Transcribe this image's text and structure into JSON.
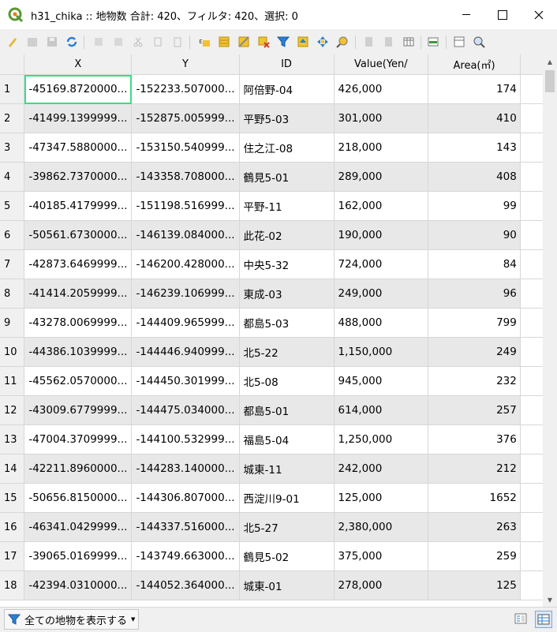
{
  "window": {
    "title": "h31_chika :: 地物数 合計: 420、フィルタ: 420、選択: 0",
    "minimize": "—",
    "maximize": "☐",
    "close": "✕"
  },
  "toolbar_icons": [
    "toggle-edit-icon",
    "multi-edit-icon",
    "save-edits-icon",
    "reload-icon",
    "add-feature-icon",
    "delete-feature-icon",
    "cut-icon",
    "copy-icon",
    "paste-icon",
    "select-by-expression-icon",
    "select-all-icon",
    "invert-selection-icon",
    "deselect-all-icon",
    "filter-select-icon",
    "move-selection-to-top-icon",
    "pan-to-selection-icon",
    "zoom-to-selection-icon",
    "copy-rows-icon",
    "paste-rows-icon",
    "delete-field-icon",
    "new-field-icon",
    "conditional-format-icon",
    "field-calculator-icon",
    "actions-icon"
  ],
  "table": {
    "columns": [
      "X",
      "Y",
      "ID",
      "Value(Yen/",
      "Area(㎡)"
    ],
    "rows": [
      {
        "n": "1",
        "x": "-45169.8720000...",
        "y": "-152233.507000...",
        "id": "阿倍野-04",
        "value": "426,000",
        "area": "174"
      },
      {
        "n": "2",
        "x": "-41499.1399999...",
        "y": "-152875.005999...",
        "id": "平野5-03",
        "value": "301,000",
        "area": "410"
      },
      {
        "n": "3",
        "x": "-47347.5880000...",
        "y": "-153150.540999...",
        "id": "住之江-08",
        "value": "218,000",
        "area": "143"
      },
      {
        "n": "4",
        "x": "-39862.7370000...",
        "y": "-143358.708000...",
        "id": "鶴見5-01",
        "value": "289,000",
        "area": "408"
      },
      {
        "n": "5",
        "x": "-40185.4179999...",
        "y": "-151198.516999...",
        "id": "平野-11",
        "value": "162,000",
        "area": "99"
      },
      {
        "n": "6",
        "x": "-50561.6730000...",
        "y": "-146139.084000...",
        "id": "此花-02",
        "value": "190,000",
        "area": "90"
      },
      {
        "n": "7",
        "x": "-42873.6469999...",
        "y": "-146200.428000...",
        "id": "中央5-32",
        "value": "724,000",
        "area": "84"
      },
      {
        "n": "8",
        "x": "-41414.2059999...",
        "y": "-146239.106999...",
        "id": "東成-03",
        "value": "249,000",
        "area": "96"
      },
      {
        "n": "9",
        "x": "-43278.0069999...",
        "y": "-144409.965999...",
        "id": "都島5-03",
        "value": "488,000",
        "area": "799"
      },
      {
        "n": "10",
        "x": "-44386.1039999...",
        "y": "-144446.940999...",
        "id": "北5-22",
        "value": "1,150,000",
        "area": "249"
      },
      {
        "n": "11",
        "x": "-45562.0570000...",
        "y": "-144450.301999...",
        "id": "北5-08",
        "value": "945,000",
        "area": "232"
      },
      {
        "n": "12",
        "x": "-43009.6779999...",
        "y": "-144475.034000...",
        "id": "都島5-01",
        "value": "614,000",
        "area": "257"
      },
      {
        "n": "13",
        "x": "-47004.3709999...",
        "y": "-144100.532999...",
        "id": "福島5-04",
        "value": "1,250,000",
        "area": "376"
      },
      {
        "n": "14",
        "x": "-42211.8960000...",
        "y": "-144283.140000...",
        "id": "城東-11",
        "value": "242,000",
        "area": "212"
      },
      {
        "n": "15",
        "x": "-50656.8150000...",
        "y": "-144306.807000...",
        "id": "西淀川9-01",
        "value": "125,000",
        "area": "1652"
      },
      {
        "n": "16",
        "x": "-46341.0429999...",
        "y": "-144337.516000...",
        "id": "北5-27",
        "value": "2,380,000",
        "area": "263"
      },
      {
        "n": "17",
        "x": "-39065.0169999...",
        "y": "-143749.663000...",
        "id": "鶴見5-02",
        "value": "375,000",
        "area": "259"
      },
      {
        "n": "18",
        "x": "-42394.0310000...",
        "y": "-144052.364000...",
        "id": "城東-01",
        "value": "278,000",
        "area": "125"
      }
    ]
  },
  "status": {
    "filter_label": "全ての地物を表示する",
    "filter_arrow": "▼"
  },
  "colors": {
    "selection_outline": "#3ddc84",
    "alt_row": "#e8e8e8",
    "header_bg": "#f0f0f0"
  }
}
